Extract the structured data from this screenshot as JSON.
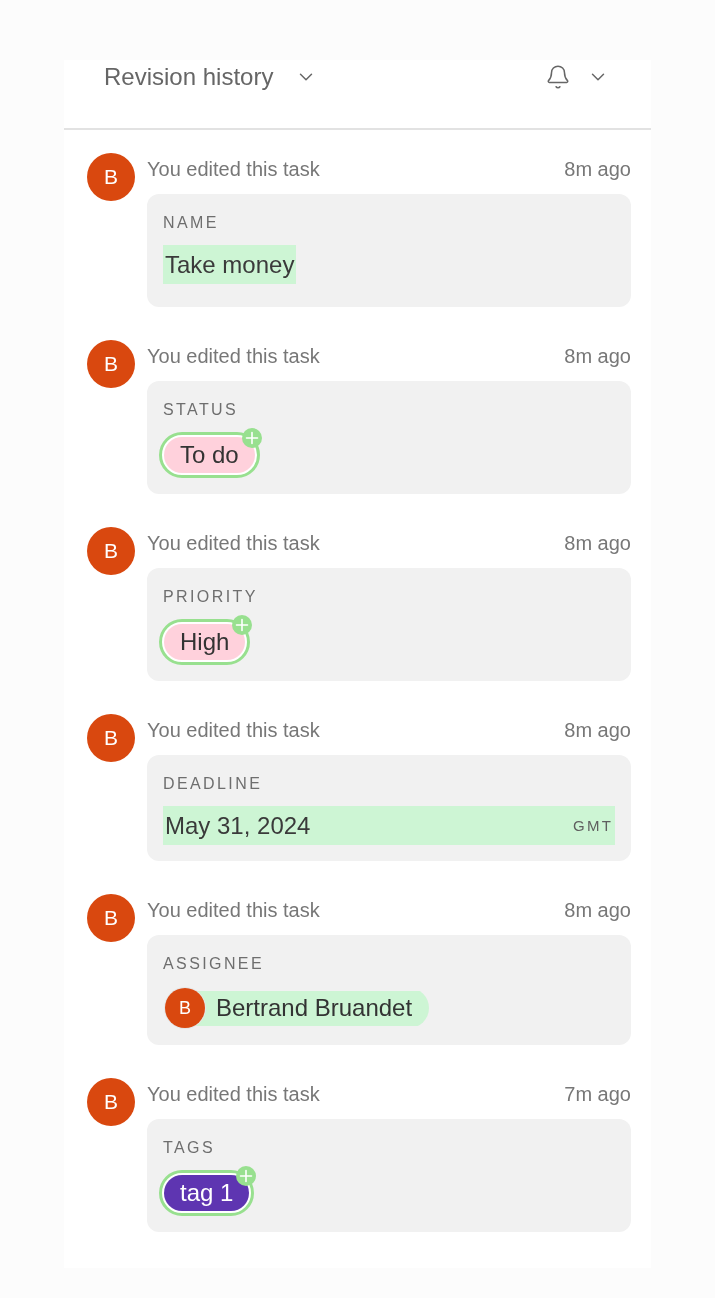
{
  "header": {
    "title": "Revision history"
  },
  "entries": [
    {
      "avatar": "B",
      "summary": "You edited this task",
      "time": "8m ago",
      "field": "NAME",
      "change": {
        "kind": "text",
        "value": "Take money"
      }
    },
    {
      "avatar": "B",
      "summary": "You edited this task",
      "time": "8m ago",
      "field": "STATUS",
      "change": {
        "kind": "pill",
        "value": "To do",
        "color": "#ffd1dc",
        "added": true
      }
    },
    {
      "avatar": "B",
      "summary": "You edited this task",
      "time": "8m ago",
      "field": "PRIORITY",
      "change": {
        "kind": "pill",
        "value": "High",
        "color": "#ffd1dc",
        "added": true
      }
    },
    {
      "avatar": "B",
      "summary": "You edited this task",
      "time": "8m ago",
      "field": "DEADLINE",
      "change": {
        "kind": "date",
        "value": "May 31, 2024",
        "zone": "GMT"
      }
    },
    {
      "avatar": "B",
      "summary": "You edited this task",
      "time": "8m ago",
      "field": "ASSIGNEE",
      "change": {
        "kind": "person",
        "avatar": "B",
        "value": "Bertrand Bruandet"
      }
    },
    {
      "avatar": "B",
      "summary": "You edited this task",
      "time": "7m ago",
      "field": "TAGS",
      "change": {
        "kind": "pill",
        "value": "tag 1",
        "color": "#5e35b1",
        "added": true
      }
    }
  ]
}
